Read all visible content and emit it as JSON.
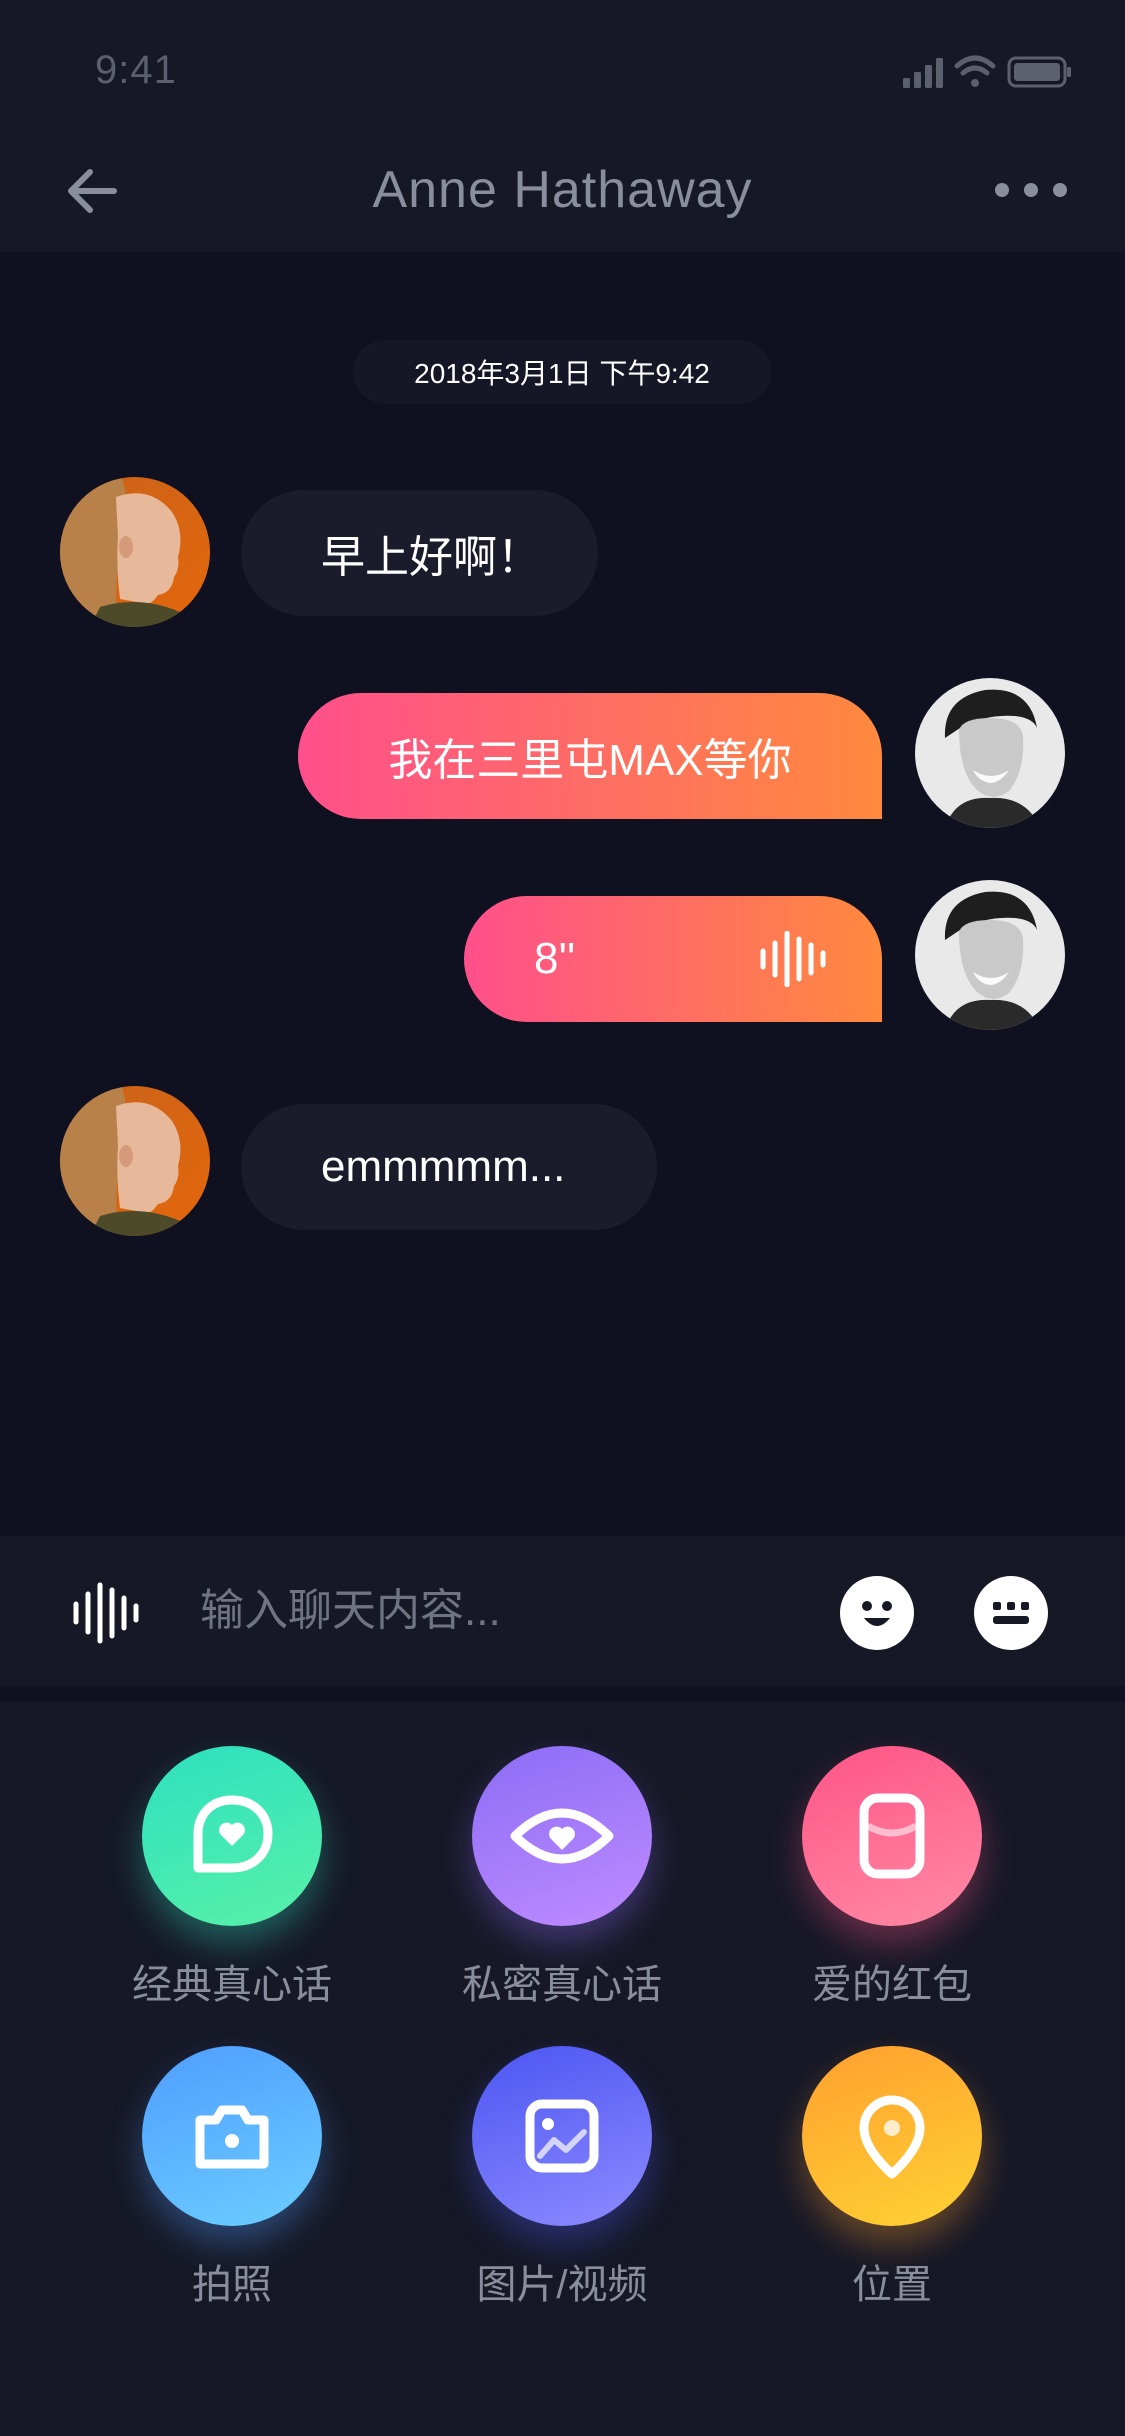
{
  "status_bar": {
    "time": "9:41",
    "icons": [
      "signal-icon",
      "wifi-icon",
      "battery-icon"
    ]
  },
  "nav": {
    "title": "Anne Hathaway",
    "back_icon": "back-arrow-icon",
    "more_icon": "more-dots-icon"
  },
  "chat": {
    "timestamp": "2018年3月1日  下午9:42",
    "messages": [
      {
        "direction": "in",
        "type": "text",
        "text": "早上好啊！"
      },
      {
        "direction": "out",
        "type": "text",
        "text": "我在三里屯MAX等你"
      },
      {
        "direction": "out",
        "type": "voice",
        "duration": "8''"
      },
      {
        "direction": "in",
        "type": "text",
        "text": "emmmmm..."
      }
    ]
  },
  "input": {
    "placeholder": "输入聊天内容...",
    "voice_icon": "voice-wave-icon",
    "emoji_icon": "emoji-icon",
    "keyboard_icon": "keyboard-icon"
  },
  "tools": [
    {
      "label": "经典真心话",
      "icon": "heart-chat-icon",
      "colors": [
        "#2de0c0",
        "#58f1a8"
      ]
    },
    {
      "label": "私密真心话",
      "icon": "heart-eye-icon",
      "colors": [
        "#8b6df6",
        "#c08bff"
      ]
    },
    {
      "label": "爱的红包",
      "icon": "red-packet-icon",
      "colors": [
        "#ff5486",
        "#ff8aa5"
      ]
    },
    {
      "label": "拍照",
      "icon": "camera-icon",
      "colors": [
        "#4f9dff",
        "#6ccdff"
      ]
    },
    {
      "label": "图片/视频",
      "icon": "image-icon",
      "colors": [
        "#4b55f2",
        "#8d8bff"
      ]
    },
    {
      "label": "位置",
      "icon": "location-pin-icon",
      "colors": [
        "#ff9f2f",
        "#ffd233"
      ]
    }
  ],
  "colors": {
    "background": "#0f1020",
    "bar": "#161826",
    "incoming_bubble": "#1a1c2b",
    "outgoing_gradient": [
      "#ff4f8c",
      "#ff8a3d"
    ]
  }
}
